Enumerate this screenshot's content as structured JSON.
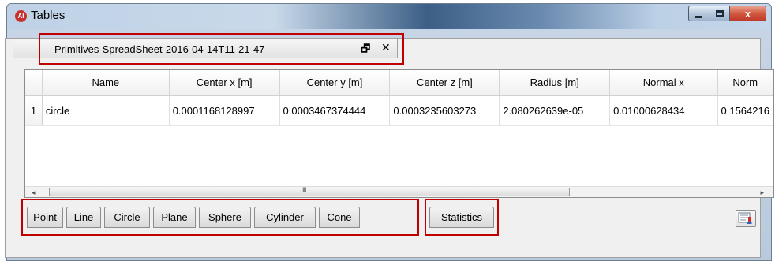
{
  "window": {
    "title": "Tables",
    "app_icon_text": "AI",
    "close_glyph": "x"
  },
  "doc_tab": {
    "label": "Primitives-SpreadSheet-2016-04-14T11-21-47",
    "float_glyph": "🗗",
    "close_glyph": "✕"
  },
  "table": {
    "columns": [
      "Name",
      "Center x [m]",
      "Center y [m]",
      "Center z [m]",
      "Radius [m]",
      "Normal x",
      "Norm"
    ],
    "rows": [
      {
        "index": "1",
        "cells": [
          "circle",
          "0.0001168128997",
          "0.0003467374444",
          "0.0003235603273",
          "2.080262639e-05",
          "0.01000628434",
          "0.1564216"
        ]
      }
    ]
  },
  "scrollbar": {
    "left_arrow": "◂",
    "right_arrow": "▸",
    "grip": "III"
  },
  "primitive_tabs": [
    "Point",
    "Line",
    "Circle",
    "Plane",
    "Sphere",
    "Cylinder",
    "Cone"
  ],
  "statistics_tab": "Statistics",
  "icons": {
    "export": "export-chart-icon"
  },
  "colors": {
    "highlight": "#c00000",
    "close_button": "#c0392b"
  }
}
